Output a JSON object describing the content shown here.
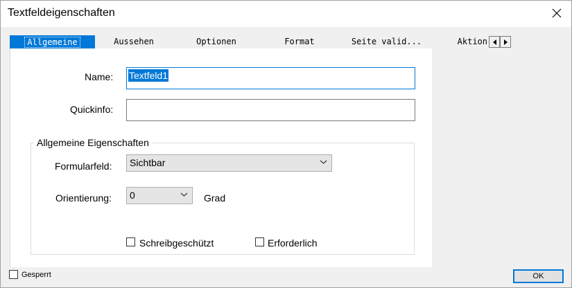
{
  "window": {
    "title": "Textfeldeigenschaften"
  },
  "tabs": [
    {
      "label": "Allgemeine",
      "active": true
    },
    {
      "label": "Aussehen",
      "active": false
    },
    {
      "label": "Optionen",
      "active": false
    },
    {
      "label": "Format",
      "active": false
    },
    {
      "label": "Seite valid...",
      "active": false
    },
    {
      "label": "Aktion",
      "active": false
    }
  ],
  "fields": {
    "name_label": "Name:",
    "name_value": "Textfeld1",
    "quickinfo_label": "Quickinfo:",
    "quickinfo_value": ""
  },
  "group": {
    "title": "Allgemeine Eigenschaften",
    "formularfeld_label": "Formularfeld:",
    "formularfeld_value": "Sichtbar",
    "orientierung_label": "Orientierung:",
    "orientierung_value": "0",
    "orientierung_unit": "Grad",
    "schreibgeschuetzt_label": "Schreibgeschützt",
    "schreibgeschuetzt_checked": false,
    "erforderlich_label": "Erforderlich",
    "erforderlich_checked": false
  },
  "footer": {
    "gesperrt_label": "Gesperrt",
    "gesperrt_checked": false,
    "ok_label": "OK"
  },
  "colors": {
    "accent": "#0078d7",
    "panel": "#ffffff",
    "background": "#f0f0f0"
  }
}
